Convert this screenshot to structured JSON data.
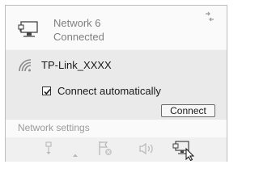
{
  "network": {
    "name": "Network 6",
    "status": "Connected",
    "icon": "ethernet-monitor-icon",
    "pin_icon": "pin-arrows-icon"
  },
  "wifi": {
    "icon": "wifi-signal-icon",
    "ssid": "TP-Link_XXXX",
    "auto_connect_label": "Connect automatically",
    "auto_connect_checked": true,
    "connect_button": "Connect"
  },
  "settings": {
    "link_label": "Network settings"
  },
  "tray": {
    "icons": [
      "usb-icon",
      "chevron-up-icon",
      "flag-blocked-icon",
      "speaker-icon",
      "network-active-icon"
    ]
  },
  "colors": {
    "panel_bg": "#f4f4f4",
    "top_bg": "#fafafa",
    "wifi_bg": "#eaeaea",
    "tray_bg": "#f0f0f0",
    "muted_text": "#7f7f7f",
    "text": "#1a1a1a"
  }
}
